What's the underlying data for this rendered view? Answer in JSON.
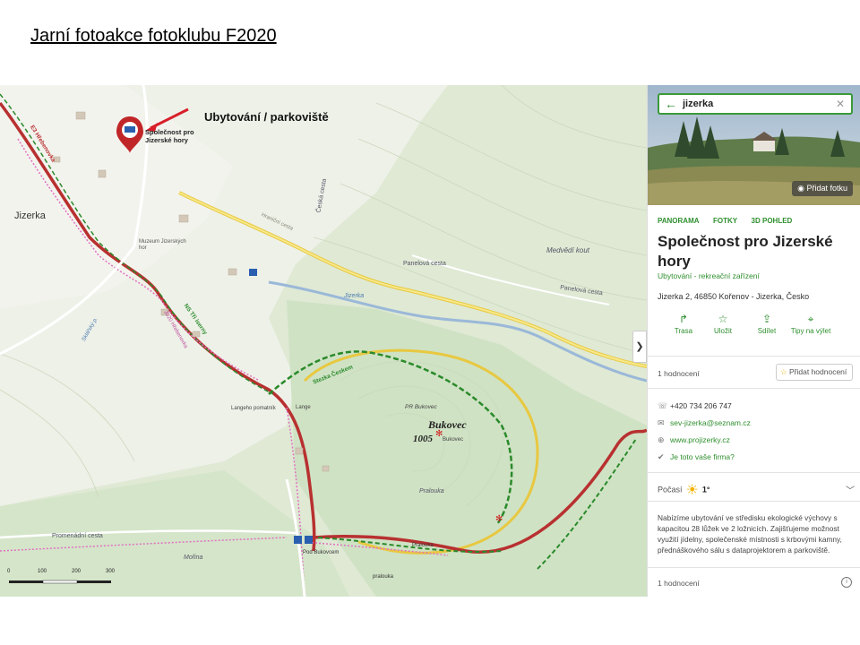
{
  "slide": {
    "title": "Jarní fotoakce fotoklubu F2020"
  },
  "map": {
    "annotation": "Ubytování / parkoviště",
    "marker_label": "Společnost pro Jizerské hory",
    "labels": {
      "jizerka": "Jizerka",
      "muzeum": "Muzeum Jizerských hor",
      "medvedi_kout": "Medvědí kout",
      "panelova_cesta": "Panelová cesta",
      "panelova_cesta_2": "Panelová cesta",
      "jizerka_river": "Jizerka",
      "cesta_cesta": "Česká cesta",
      "bukovec": "Bukovec",
      "bukovec_elev": "1005",
      "bukovec_small": "Bukovec",
      "pr_bukovec": "PR Bukovec",
      "langeho": "Langeho pomatník",
      "lange": "Lange",
      "promenadni": "Promenádní cesta",
      "morina": "Mořina",
      "pod_bukovcem": "Pod Bukovcem",
      "pralouka": "Pralouka",
      "pralouka_2": "Pralouka",
      "pralouka_3": "pralouka",
      "ns_tri_iserny": "NS Tři iserny",
      "e3_hrebenovka": "E3 Hřebenovka",
      "stezka_ceskem": "Stezka Českem",
      "hrebenovka_3020": "3020 Hřebenovka",
      "sklarsky": "Sklářský p.",
      "hraniční": "Hraniční cesta"
    },
    "scale": {
      "ticks": [
        "0",
        "100",
        "200",
        "300"
      ]
    },
    "collapse_icon": "chevron-right-icon"
  },
  "panel": {
    "search": {
      "query": "jizerka",
      "back_icon": "arrow-left-icon",
      "clear_icon": "close-icon"
    },
    "add_photo": "Přidat fotku",
    "tabs": [
      "PANORAMA",
      "FOTKY",
      "3D POHLED"
    ],
    "title": "Společnost pro Jizerské hory",
    "category": "Ubytování - rekreační zařízení",
    "address": "Jizerka 2, 46850 Kořenov - Jizerka, Česko",
    "actions": [
      {
        "icon": "route-icon",
        "label": "Trasa"
      },
      {
        "icon": "star-icon",
        "label": "Uložit"
      },
      {
        "icon": "share-icon",
        "label": "Sdílet"
      },
      {
        "icon": "pin-icon",
        "label": "Tipy na výlet"
      }
    ],
    "ratings_count": "1 hodnocení",
    "add_rating": "Přidat hodnocení",
    "contacts": {
      "phone": "+420 734 206 747",
      "email": "sev-jizerka@seznam.cz",
      "web": "www.projizerky.cz",
      "claim": "Je toto vaše firma?"
    },
    "weather": {
      "label": "Počasí",
      "temp": "1°"
    },
    "description": "Nabízíme ubytování ve středisku ekologické výchovy s kapacitou 28 lůžek ve 2 ložnicích. Zajišťujeme možnost využití jídelny, společenské místnosti s krbovými kamny, přednáškového sálu s dataprojektorem a parkoviště.",
    "ratings_bottom": "1 hodnocení",
    "colors": {
      "accent": "#2f8f2f",
      "trail_red": "#c0242a",
      "trail_green": "#2a8a2a",
      "road_yellow": "#f0d030"
    }
  }
}
